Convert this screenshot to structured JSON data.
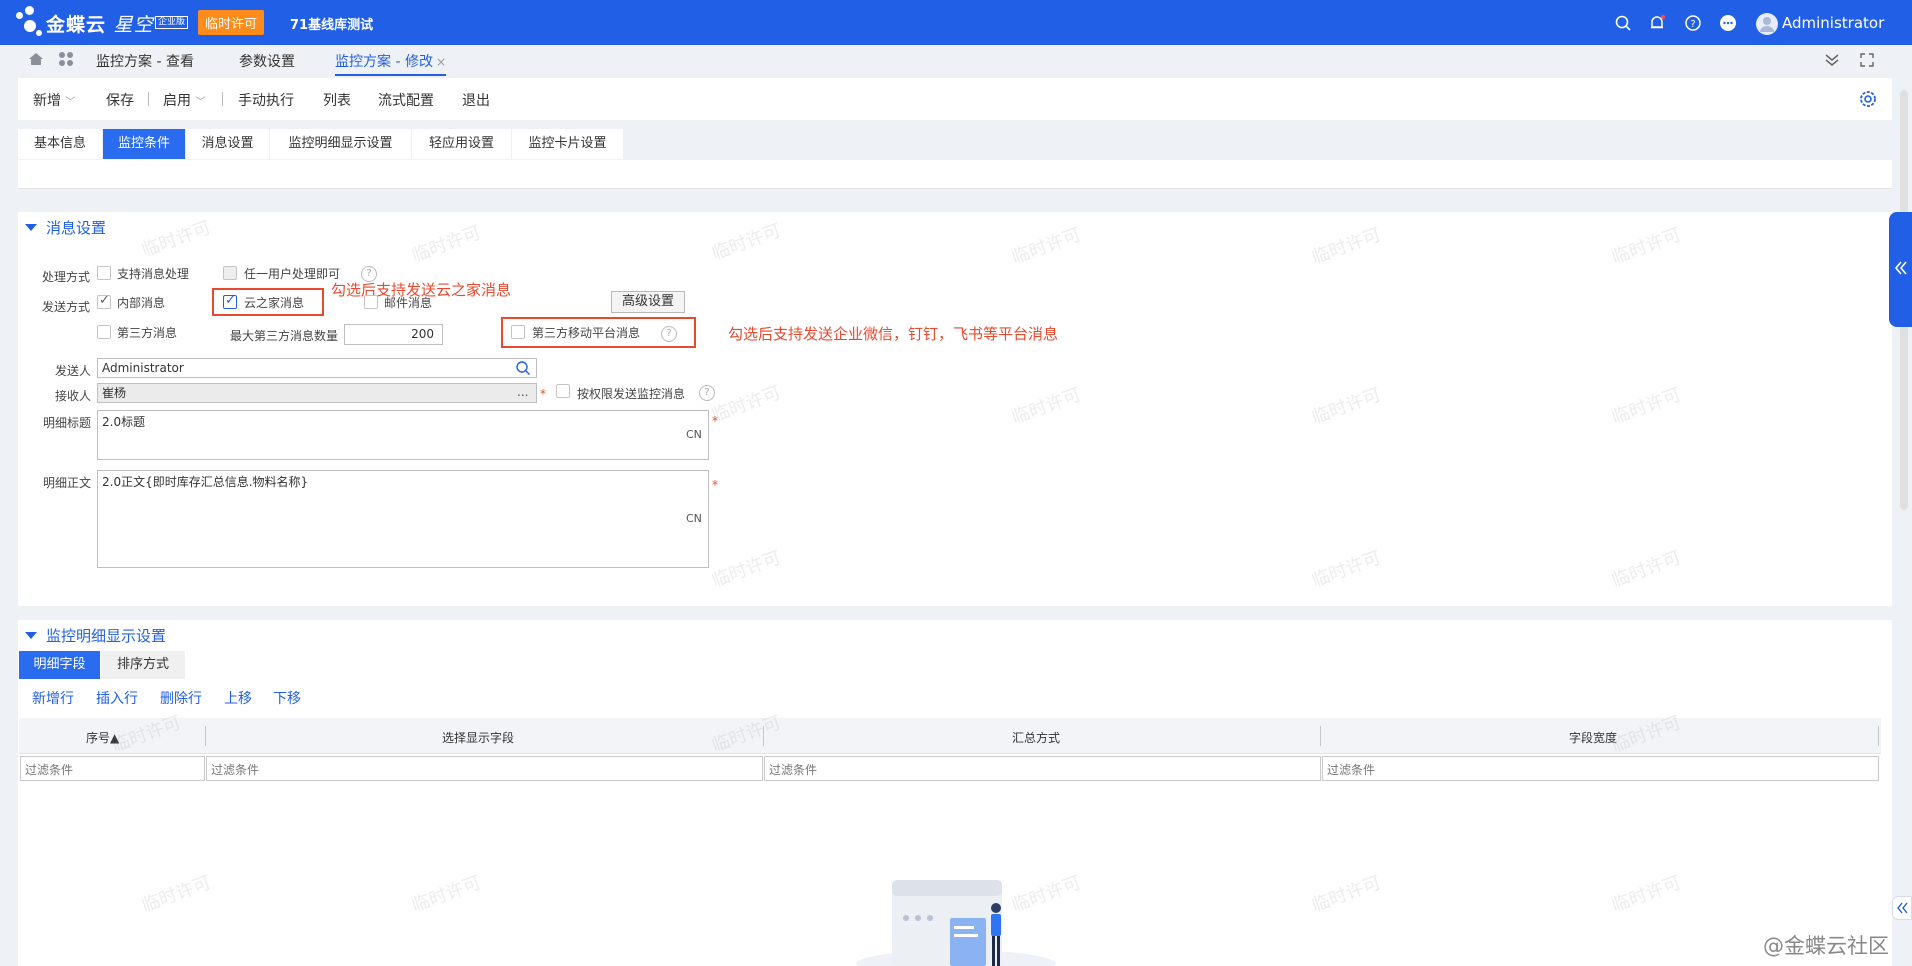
{
  "app": {
    "brand": "金蝶云",
    "brand_sub": "星空",
    "edition": "企业版",
    "license_tag": "临时许可",
    "tenant": "71基线库测试",
    "user": "Administrator"
  },
  "page_tabs": [
    {
      "label": "监控方案 - 查看"
    },
    {
      "label": "参数设置"
    },
    {
      "label": "监控方案 - 修改",
      "close": "×"
    }
  ],
  "toolbar": {
    "new": "新增",
    "save": "保存",
    "enable": "启用",
    "manual_run": "手动执行",
    "list": "列表",
    "workflow": "流式配置",
    "exit": "退出"
  },
  "form_tabs": [
    "基本信息",
    "监控条件",
    "消息设置",
    "监控明细显示设置",
    "轻应用设置",
    "监控卡片设置"
  ],
  "msg_section": {
    "title": "消息设置",
    "handle_mode_label": "处理方式",
    "support_msg_handle": "支持消息处理",
    "any_user_handle": "任一用户处理即可",
    "send_mode_label": "发送方式",
    "internal_msg": "内部消息",
    "cloudhome_msg": "云之家消息",
    "email_msg": "邮件消息",
    "advanced_button": "高级设置",
    "third_party_msg": "第三方消息",
    "max_third_party_label": "最大第三方消息数量",
    "max_third_party_value": "200",
    "third_party_mobile_msg": "第三方移动平台消息",
    "sender_label": "发送人",
    "sender_value": "Administrator",
    "receiver_label": "接收人",
    "receiver_value": "崔杨",
    "receiver_more": "...",
    "by_permission": "按权限发送监控消息",
    "detail_title_label": "明细标题",
    "detail_title_value": "2.0标题",
    "detail_body_label": "明细正文",
    "detail_body_value": "2.0正文{即时库存汇总信息.物料名称}",
    "lang": "CN",
    "required_mark": "*",
    "help": "?"
  },
  "annotations": {
    "cloudhome": "勾选后支持发送云之家消息",
    "third_party": "勾选后支持发送企业微信，钉钉，飞书等平台消息"
  },
  "detail_section": {
    "title": "监控明细显示设置",
    "subtabs": [
      "明细字段",
      "排序方式"
    ],
    "actions": [
      "新增行",
      "插入行",
      "删除行",
      "上移",
      "下移"
    ],
    "columns": [
      "序号▲",
      "选择显示字段",
      "汇总方式",
      "字段宽度"
    ],
    "filter_placeholder": "过滤条件"
  },
  "watermark_text": "临时许可",
  "community": "@金蝶云社区"
}
